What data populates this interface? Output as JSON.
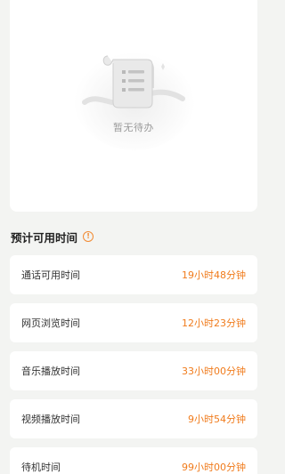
{
  "todo": {
    "empty_text": "暂无待办"
  },
  "usage": {
    "title": "预计可用时间",
    "info_icon": "info-circle-icon",
    "accent_color": "#f07b1c",
    "rows": [
      {
        "label": "通话可用时间",
        "value": "19小时48分钟"
      },
      {
        "label": "网页浏览时间",
        "value": "12小时23分钟"
      },
      {
        "label": "音乐播放时间",
        "value": "33小时00分钟"
      },
      {
        "label": "视频播放时间",
        "value": "9小时54分钟"
      },
      {
        "label": "待机时间",
        "value": "99小时00分钟"
      }
    ]
  }
}
